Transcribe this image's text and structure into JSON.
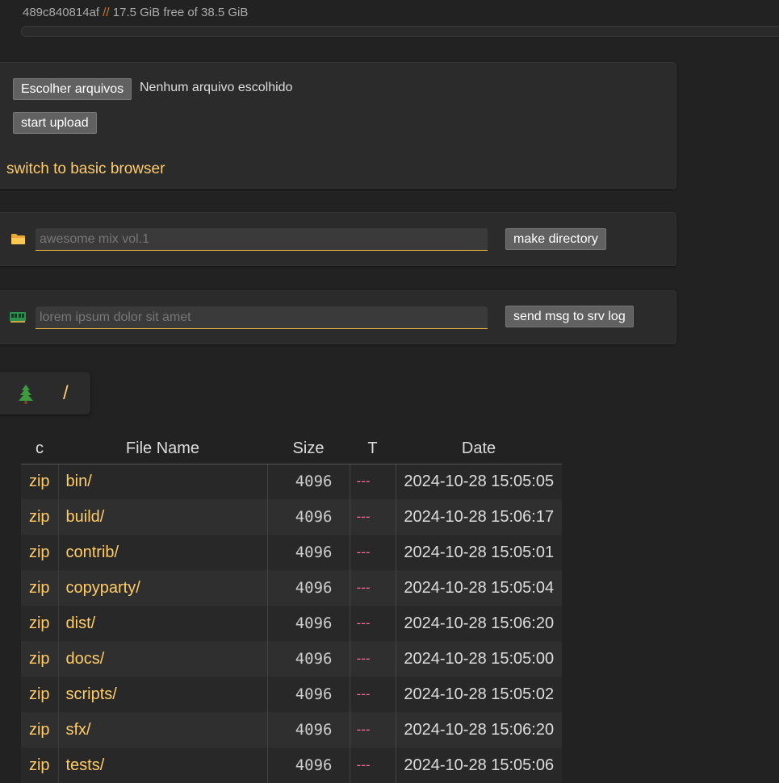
{
  "server": {
    "host_id": "489c840814af",
    "separator": "//",
    "disk_free": "17.5 GiB free of 38.5 GiB"
  },
  "upload": {
    "choose_files_label": "Escolher arquivos",
    "no_file_text": "Nenhum arquivo escolhido",
    "start_upload_label": "start upload",
    "basic_browser_link": "switch to basic browser"
  },
  "mkdir": {
    "icon": "folder-icon",
    "placeholder": "awesome mix vol.1",
    "button_label": "make directory"
  },
  "msg": {
    "icon": "ram-icon",
    "placeholder": "lorem ipsum dolor sit amet",
    "button_label": "send msg to srv log"
  },
  "path": {
    "tree_icon": "tree-icon",
    "root": "/"
  },
  "colors": {
    "background": "#222222",
    "panel": "#2b2b2b",
    "link": "#ffcc66",
    "type_dash": "#ff6699",
    "input_underline": "#e0b040"
  },
  "table": {
    "headers": {
      "c": "c",
      "name": "File Name",
      "size": "Size",
      "t": "T",
      "date": "Date"
    },
    "rows": [
      {
        "c": "zip",
        "name": "bin/",
        "size": "4096",
        "t": "---",
        "date": "2024-10-28 15:05:05"
      },
      {
        "c": "zip",
        "name": "build/",
        "size": "4096",
        "t": "---",
        "date": "2024-10-28 15:06:17"
      },
      {
        "c": "zip",
        "name": "contrib/",
        "size": "4096",
        "t": "---",
        "date": "2024-10-28 15:05:01"
      },
      {
        "c": "zip",
        "name": "copyparty/",
        "size": "4096",
        "t": "---",
        "date": "2024-10-28 15:05:04"
      },
      {
        "c": "zip",
        "name": "dist/",
        "size": "4096",
        "t": "---",
        "date": "2024-10-28 15:06:20"
      },
      {
        "c": "zip",
        "name": "docs/",
        "size": "4096",
        "t": "---",
        "date": "2024-10-28 15:05:00"
      },
      {
        "c": "zip",
        "name": "scripts/",
        "size": "4096",
        "t": "---",
        "date": "2024-10-28 15:05:02"
      },
      {
        "c": "zip",
        "name": "sfx/",
        "size": "4096",
        "t": "---",
        "date": "2024-10-28 15:06:20"
      },
      {
        "c": "zip",
        "name": "tests/",
        "size": "4096",
        "t": "---",
        "date": "2024-10-28 15:05:06"
      }
    ]
  }
}
